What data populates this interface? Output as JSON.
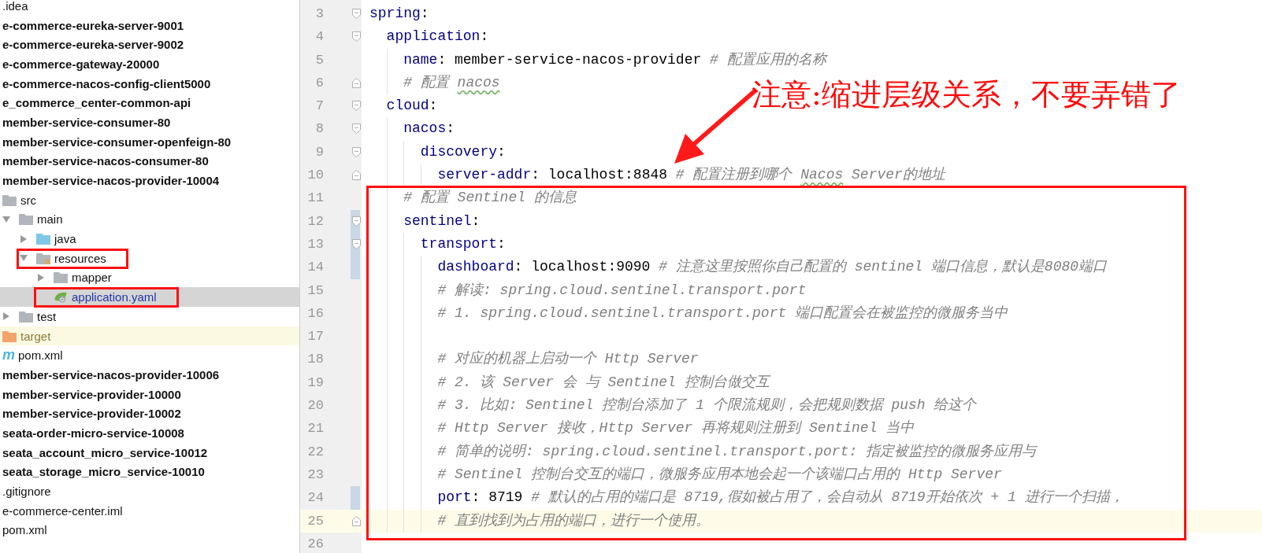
{
  "tree": [
    {
      "label": ".idea",
      "kind": "plain",
      "selected": false
    },
    {
      "label": "e-commerce-eureka-server-9001",
      "kind": "module",
      "selected": false
    },
    {
      "label": "e-commerce-eureka-server-9002",
      "kind": "module",
      "selected": false
    },
    {
      "label": "e-commerce-gateway-20000",
      "kind": "module",
      "selected": false
    },
    {
      "label": "e-commerce-nacos-config-client5000",
      "kind": "module",
      "selected": false
    },
    {
      "label": "e_commerce_center-common-api",
      "kind": "module",
      "selected": false
    },
    {
      "label": "member-service-consumer-80",
      "kind": "module",
      "selected": false
    },
    {
      "label": "member-service-consumer-openfeign-80",
      "kind": "module",
      "selected": false
    },
    {
      "label": "member-service-nacos-consumer-80",
      "kind": "module",
      "selected": false
    },
    {
      "label": "member-service-nacos-provider-10004",
      "kind": "module",
      "selected": false,
      "children": [
        {
          "label": "src",
          "kind": "folder",
          "selected": false,
          "children": [
            {
              "label": "main",
              "kind": "folder",
              "selected": false,
              "expanded": true,
              "children": [
                {
                  "label": "java",
                  "kind": "source-folder",
                  "selected": false,
                  "expanded": false
                },
                {
                  "label": "resources",
                  "kind": "resource-folder",
                  "selected": false,
                  "expanded": true,
                  "annotated": true,
                  "children": [
                    {
                      "label": "mapper",
                      "kind": "folder",
                      "selected": false,
                      "expanded": false
                    },
                    {
                      "label": "application.yaml",
                      "kind": "spring-file",
                      "selected": true,
                      "annotated": true,
                      "modified": true
                    }
                  ]
                }
              ]
            },
            {
              "label": "test",
              "kind": "folder",
              "selected": false,
              "expanded": false
            }
          ]
        },
        {
          "label": "target",
          "kind": "excluded-folder",
          "selected": false
        },
        {
          "label": "pom.xml",
          "kind": "maven-file",
          "icon_text": "m",
          "selected": false
        }
      ]
    },
    {
      "label": "member-service-nacos-provider-10006",
      "kind": "module",
      "selected": false
    },
    {
      "label": "member-service-provider-10000",
      "kind": "module",
      "selected": false
    },
    {
      "label": "member-service-provider-10002",
      "kind": "module",
      "selected": false
    },
    {
      "label": "seata-order-micro-service-10008",
      "kind": "module",
      "selected": false
    },
    {
      "label": "seata_account_micro_service-10012",
      "kind": "module",
      "selected": false
    },
    {
      "label": "seata_storage_micro_service-10010",
      "kind": "module",
      "selected": false
    },
    {
      "label": ".gitignore",
      "kind": "plain",
      "selected": false
    },
    {
      "label": "e-commerce-center.iml",
      "kind": "plain",
      "selected": false
    },
    {
      "label": "pom.xml",
      "kind": "plain",
      "selected": false
    }
  ],
  "editor": {
    "lines": [
      {
        "number": "3",
        "fold_open": true,
        "tokens": [
          {
            "kind": "key",
            "text": "spring"
          },
          {
            "kind": "plain",
            "text": ":"
          }
        ],
        "children": [
          {
            "number": "4",
            "fold_open": true,
            "tokens": [
              {
                "kind": "key",
                "text": "application"
              },
              {
                "kind": "plain",
                "text": ":"
              }
            ],
            "children": [
              {
                "number": "5",
                "tokens": [
                  {
                    "kind": "key",
                    "text": "name"
                  },
                  {
                    "kind": "plain",
                    "text": ": member-service-nacos-provider "
                  },
                  {
                    "kind": "comment",
                    "text": "# 配置应用的名称"
                  }
                ]
              },
              {
                "number": "6",
                "fold_close": true,
                "tokens": [
                  {
                    "kind": "comment",
                    "text": "# 配置 "
                  },
                  {
                    "kind": "comment",
                    "text": "nacos",
                    "typo": true
                  }
                ]
              }
            ]
          },
          {
            "number": "7",
            "fold_open": true,
            "tokens": [
              {
                "kind": "key",
                "text": "cloud"
              },
              {
                "kind": "plain",
                "text": ":"
              }
            ],
            "children": [
              {
                "number": "8",
                "fold_open": true,
                "tokens": [
                  {
                    "kind": "key",
                    "text": "nacos"
                  },
                  {
                    "kind": "plain",
                    "text": ":"
                  }
                ],
                "children": [
                  {
                    "number": "9",
                    "fold_open": true,
                    "tokens": [
                      {
                        "kind": "key",
                        "text": "discovery"
                      },
                      {
                        "kind": "plain",
                        "text": ":"
                      }
                    ],
                    "children": [
                      {
                        "number": "10",
                        "fold_close": true,
                        "tokens": [
                          {
                            "kind": "key",
                            "text": "server-addr"
                          },
                          {
                            "kind": "plain",
                            "text": ": localhost:8848 "
                          },
                          {
                            "kind": "comment",
                            "text": "# 配置注册到哪个 "
                          },
                          {
                            "kind": "comment",
                            "text": "Nacos",
                            "typo": true
                          },
                          {
                            "kind": "comment",
                            "text": " Server的地址"
                          }
                        ]
                      }
                    ]
                  }
                ]
              },
              {
                "number": "11",
                "boxed": true,
                "tokens": [
                  {
                    "kind": "comment",
                    "text": "# 配置 Sentinel 的信息"
                  }
                ]
              },
              {
                "number": "12",
                "boxed": true,
                "changed": true,
                "fold_open": true,
                "tokens": [
                  {
                    "kind": "key",
                    "text": "sentinel"
                  },
                  {
                    "kind": "plain",
                    "text": ":"
                  }
                ],
                "children": [
                  {
                    "number": "13",
                    "boxed": true,
                    "changed": true,
                    "fold_open": true,
                    "tokens": [
                      {
                        "kind": "key",
                        "text": "transport"
                      },
                      {
                        "kind": "plain",
                        "text": ":"
                      }
                    ],
                    "children": [
                      {
                        "number": "14",
                        "boxed": true,
                        "changed": true,
                        "tokens": [
                          {
                            "kind": "key",
                            "text": "dashboard"
                          },
                          {
                            "kind": "plain",
                            "text": ": localhost:9090 "
                          },
                          {
                            "kind": "comment",
                            "text": "# 注意这里按照你自己配置的 sentinel 端口信息，默认是8080端口"
                          }
                        ]
                      },
                      {
                        "number": "15",
                        "boxed": true,
                        "tokens": [
                          {
                            "kind": "comment",
                            "text": "# 解读: spring.cloud.sentinel.transport.port"
                          }
                        ]
                      },
                      {
                        "number": "16",
                        "boxed": true,
                        "tokens": [
                          {
                            "kind": "comment",
                            "text": "# 1. spring.cloud.sentinel.transport.port 端口配置会在被监控的微服务当中"
                          }
                        ]
                      },
                      {
                        "number": "17",
                        "boxed": true
                      },
                      {
                        "number": "18",
                        "boxed": true,
                        "tokens": [
                          {
                            "kind": "comment",
                            "text": "# 对应的机器上启动一个 Http Server"
                          }
                        ]
                      },
                      {
                        "number": "19",
                        "boxed": true,
                        "tokens": [
                          {
                            "kind": "comment",
                            "text": "# 2. 该 Server 会 与 Sentinel 控制台做交互"
                          }
                        ]
                      },
                      {
                        "number": "20",
                        "boxed": true,
                        "tokens": [
                          {
                            "kind": "comment",
                            "text": "# 3. 比如: Sentinel 控制台添加了 1 个限流规则，会把规则数据 push 给这个"
                          }
                        ]
                      },
                      {
                        "number": "21",
                        "boxed": true,
                        "tokens": [
                          {
                            "kind": "comment",
                            "text": "# Http Server 接收，Http Server 再将规则注册到 Sentinel 当中"
                          }
                        ]
                      },
                      {
                        "number": "22",
                        "boxed": true,
                        "tokens": [
                          {
                            "kind": "comment",
                            "text": "# 简单的说明: spring.cloud.sentinel.transport.port: 指定被监控的微服务应用与"
                          }
                        ]
                      },
                      {
                        "number": "23",
                        "boxed": true,
                        "tokens": [
                          {
                            "kind": "comment",
                            "text": "# Sentinel 控制台交互的端口，微服务应用本地会起一个该端口占用的 Http Server"
                          }
                        ]
                      },
                      {
                        "number": "24",
                        "boxed": true,
                        "changed": true,
                        "tokens": [
                          {
                            "kind": "key",
                            "text": "port"
                          },
                          {
                            "kind": "plain",
                            "text": ": 8719 "
                          },
                          {
                            "kind": "comment",
                            "text": "# 默认的占用的端口是 8719,假如被占用了，会自动从 8719开始依次 + 1 进行一个扫描，"
                          }
                        ]
                      },
                      {
                        "number": "25",
                        "boxed": true,
                        "current": true,
                        "fold_close": true,
                        "tokens": [
                          {
                            "kind": "comment",
                            "text": "# 直到找到为占用的端口，进行一个使用。"
                          }
                        ]
                      }
                    ]
                  }
                ]
              }
            ]
          }
        ]
      },
      {
        "number": "26"
      }
    ]
  },
  "annotation": {
    "note": "注意:缩进层级关系，不要弄错了"
  }
}
